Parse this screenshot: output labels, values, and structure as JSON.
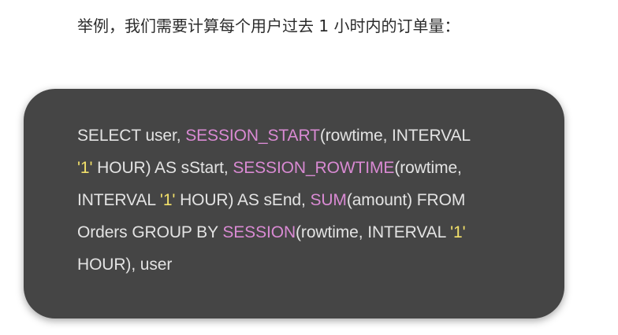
{
  "heading": "举例，我们需要计算每个用户过去 1 小时内的订单量：",
  "code": {
    "lines": [
      [
        {
          "t": "SELECT user, ",
          "k": "plain"
        },
        {
          "t": "SESSION_START",
          "k": "fn"
        },
        {
          "t": "(rowtime, INTERVAL",
          "k": "plain"
        }
      ],
      [
        {
          "t": "'1'",
          "k": "str"
        },
        {
          "t": " HOUR) AS sStart, ",
          "k": "plain"
        },
        {
          "t": "SESSION_ROWTIME",
          "k": "fn"
        },
        {
          "t": "(rowtime,",
          "k": "plain"
        }
      ],
      [
        {
          "t": "INTERVAL ",
          "k": "plain"
        },
        {
          "t": "'1'",
          "k": "str"
        },
        {
          "t": " HOUR) AS sEnd, ",
          "k": "plain"
        },
        {
          "t": "SUM",
          "k": "fn"
        },
        {
          "t": "(amount) FROM",
          "k": "plain"
        }
      ],
      [
        {
          "t": "Orders GROUP BY ",
          "k": "plain"
        },
        {
          "t": "SESSION",
          "k": "fn"
        },
        {
          "t": "(rowtime, INTERVAL ",
          "k": "plain"
        },
        {
          "t": "'1'",
          "k": "str"
        }
      ],
      [
        {
          "t": "HOUR), user",
          "k": "plain"
        }
      ]
    ]
  },
  "colors": {
    "card_background": "#454545",
    "plain_text": "#e3e3e3",
    "function_name": "#d98ad3",
    "string_literal": "#f2e06a"
  }
}
